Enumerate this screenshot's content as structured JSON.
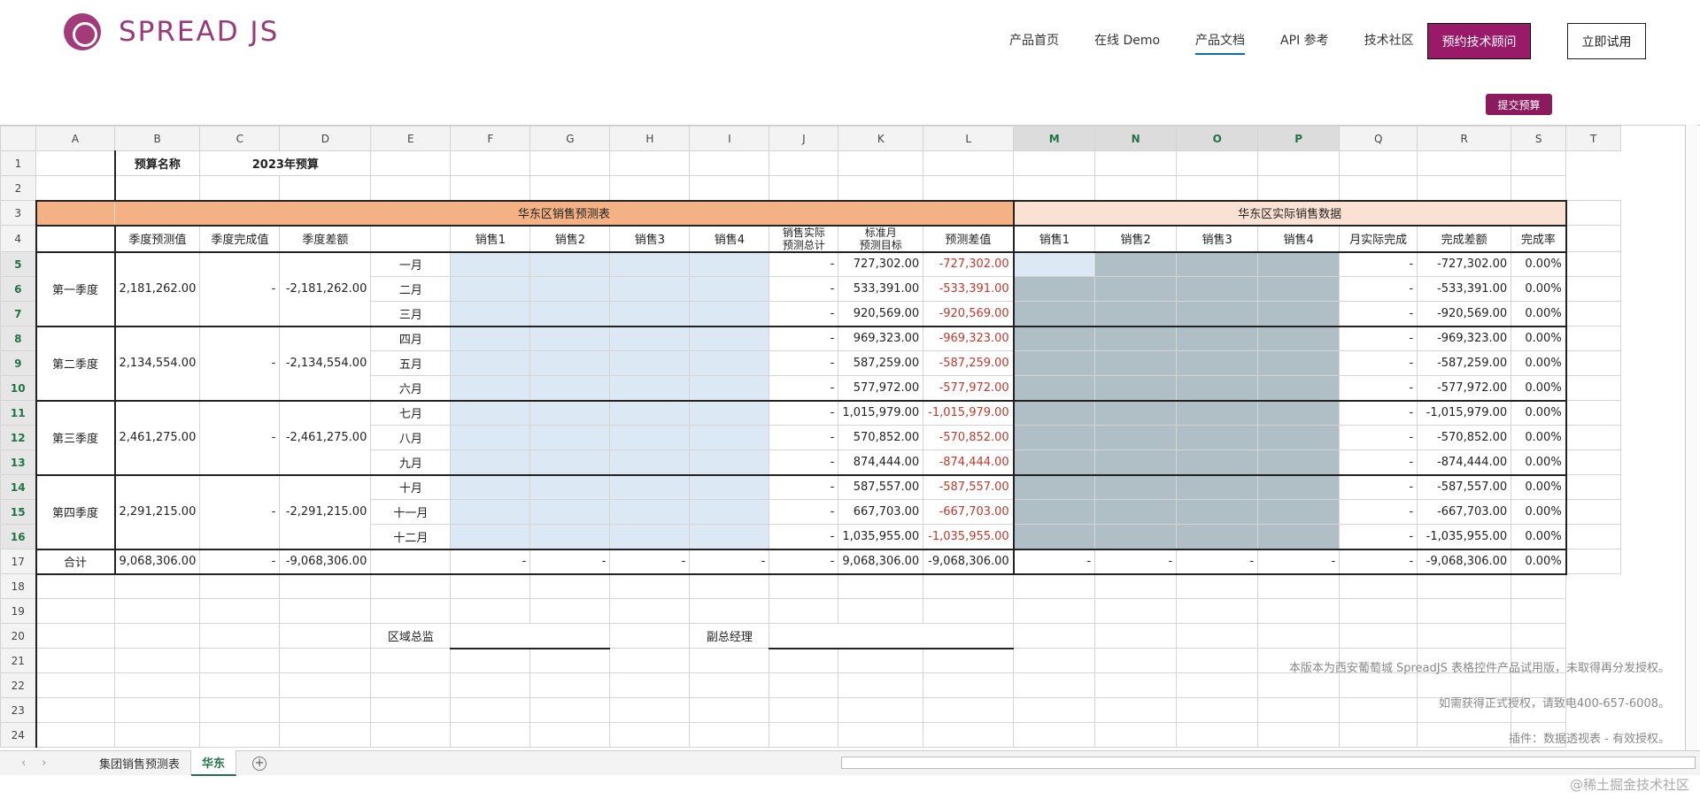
{
  "brand": {
    "name": "SPREAD JS"
  },
  "nav": {
    "items": [
      "产品首页",
      "在线 Demo",
      "产品文档",
      "API 参考",
      "技术社区"
    ],
    "active_index": 2,
    "consult_button": "预约技术顾问",
    "trial_button": "立即试用"
  },
  "submit_button": "提交预算",
  "columns": [
    "A",
    "B",
    "C",
    "D",
    "E",
    "F",
    "G",
    "H",
    "I",
    "J",
    "K",
    "L",
    "M",
    "N",
    "O",
    "P",
    "Q",
    "R",
    "S",
    "T"
  ],
  "selected_columns": [
    "M",
    "N",
    "O",
    "P"
  ],
  "rows": [
    "1",
    "2",
    "3",
    "4",
    "5",
    "6",
    "7",
    "8",
    "9",
    "10",
    "11",
    "12",
    "13",
    "14",
    "15",
    "16",
    "17",
    "18",
    "19",
    "20",
    "21",
    "22",
    "23",
    "24"
  ],
  "selected_rows": [
    "5",
    "6",
    "7",
    "8",
    "9",
    "10",
    "11",
    "12",
    "13",
    "14",
    "15",
    "16"
  ],
  "header": {
    "budget_name_label": "预算名称",
    "budget_name_value": "2023年预算",
    "forecast_title": "华东区销售预测表",
    "actual_title": "华东区实际销售数据",
    "col_quarter_forecast": "季度预测值",
    "col_quarter_done": "季度完成值",
    "col_quarter_diff": "季度差额",
    "col_sales1": "销售1",
    "col_sales2": "销售2",
    "col_sales3": "销售3",
    "col_sales4": "销售4",
    "col_actual_total_l1": "销售实际",
    "col_actual_total_l2": "预测总计",
    "col_month_target_l1": "标准月",
    "col_month_target_l2": "预测目标",
    "col_forecast_diff": "预测差值",
    "col_actual_sales1": "销售1",
    "col_actual_sales2": "销售2",
    "col_actual_sales3": "销售3",
    "col_actual_sales4": "销售4",
    "col_month_actual": "月实际完成",
    "col_done_diff": "完成差额",
    "col_done_rate": "完成率"
  },
  "quarters": [
    {
      "name": "第一季度",
      "forecast": "2,181,262.00",
      "done": "-",
      "diff": "-2,181,262.00",
      "months": [
        {
          "name": "一月",
          "total": "-",
          "target": "727,302.00",
          "fdiff": "-727,302.00",
          "mactual": "-",
          "ddiff": "-727,302.00",
          "rate": "0.00%"
        },
        {
          "name": "二月",
          "total": "-",
          "target": "533,391.00",
          "fdiff": "-533,391.00",
          "mactual": "-",
          "ddiff": "-533,391.00",
          "rate": "0.00%"
        },
        {
          "name": "三月",
          "total": "-",
          "target": "920,569.00",
          "fdiff": "-920,569.00",
          "mactual": "-",
          "ddiff": "-920,569.00",
          "rate": "0.00%"
        }
      ]
    },
    {
      "name": "第二季度",
      "forecast": "2,134,554.00",
      "done": "-",
      "diff": "-2,134,554.00",
      "months": [
        {
          "name": "四月",
          "total": "-",
          "target": "969,323.00",
          "fdiff": "-969,323.00",
          "mactual": "-",
          "ddiff": "-969,323.00",
          "rate": "0.00%"
        },
        {
          "name": "五月",
          "total": "-",
          "target": "587,259.00",
          "fdiff": "-587,259.00",
          "mactual": "-",
          "ddiff": "-587,259.00",
          "rate": "0.00%"
        },
        {
          "name": "六月",
          "total": "-",
          "target": "577,972.00",
          "fdiff": "-577,972.00",
          "mactual": "-",
          "ddiff": "-577,972.00",
          "rate": "0.00%"
        }
      ]
    },
    {
      "name": "第三季度",
      "forecast": "2,461,275.00",
      "done": "-",
      "diff": "-2,461,275.00",
      "months": [
        {
          "name": "七月",
          "total": "-",
          "target": "1,015,979.00",
          "fdiff": "-1,015,979.00",
          "mactual": "-",
          "ddiff": "-1,015,979.00",
          "rate": "0.00%"
        },
        {
          "name": "八月",
          "total": "-",
          "target": "570,852.00",
          "fdiff": "-570,852.00",
          "mactual": "-",
          "ddiff": "-570,852.00",
          "rate": "0.00%"
        },
        {
          "name": "九月",
          "total": "-",
          "target": "874,444.00",
          "fdiff": "-874,444.00",
          "mactual": "-",
          "ddiff": "-874,444.00",
          "rate": "0.00%"
        }
      ]
    },
    {
      "name": "第四季度",
      "forecast": "2,291,215.00",
      "done": "-",
      "diff": "-2,291,215.00",
      "months": [
        {
          "name": "十月",
          "total": "-",
          "target": "587,557.00",
          "fdiff": "-587,557.00",
          "mactual": "-",
          "ddiff": "-587,557.00",
          "rate": "0.00%"
        },
        {
          "name": "十一月",
          "total": "-",
          "target": "667,703.00",
          "fdiff": "-667,703.00",
          "mactual": "-",
          "ddiff": "-667,703.00",
          "rate": "0.00%"
        },
        {
          "name": "十二月",
          "total": "-",
          "target": "1,035,955.00",
          "fdiff": "-1,035,955.00",
          "mactual": "-",
          "ddiff": "-1,035,955.00",
          "rate": "0.00%"
        }
      ]
    }
  ],
  "totals": {
    "label": "合计",
    "forecast": "9,068,306.00",
    "done": "-",
    "diff": "-9,068,306.00",
    "s1": "-",
    "s2": "-",
    "s3": "-",
    "s4": "-",
    "total": "-",
    "target": "9,068,306.00",
    "fdiff": "-9,068,306.00",
    "a1": "-",
    "a2": "-",
    "a3": "-",
    "a4": "-",
    "mactual": "-",
    "ddiff": "-9,068,306.00",
    "rate": "0.00%"
  },
  "signatures": {
    "regional_director": "区域总监",
    "vice_gm": "副总经理"
  },
  "watermark": {
    "line1": "本版本为西安葡萄城 SpreadJS 表格控件产品试用版，未取得再分发授权。",
    "line2": "如需获得正式授权，请致电400-657-6008。",
    "line3": "插件：数据透视表 - 有效授权。"
  },
  "tabs": {
    "items": [
      "集团销售预测表",
      "华东"
    ],
    "active_index": 1
  },
  "footer_credit": "@稀土掘金技术社区",
  "colors": {
    "brand": "#9a1a6a",
    "forecast_header": "#f4b183",
    "actual_header": "#fbe1d3",
    "input_blue": "#dce9f5",
    "selection_gray": "#b0bec6",
    "negative_red": "#c0392b",
    "selection_green": "#217346"
  }
}
